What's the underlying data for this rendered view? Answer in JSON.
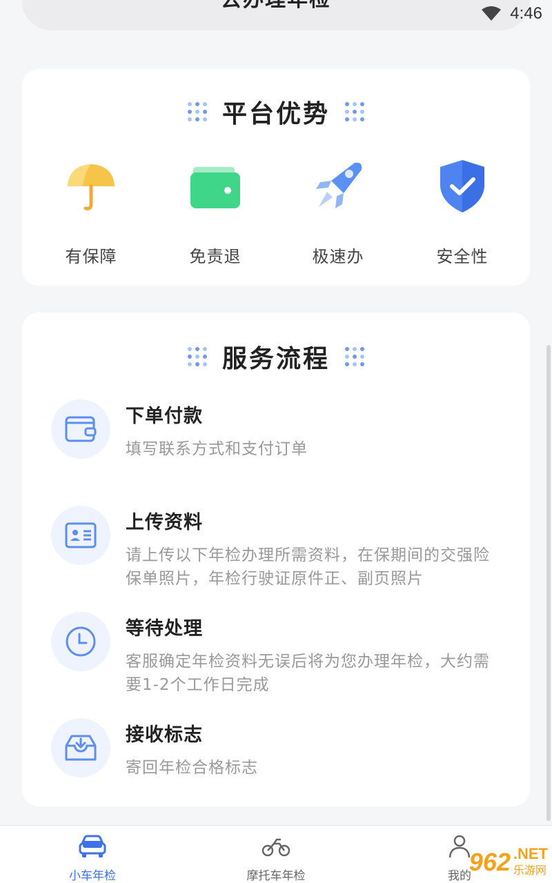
{
  "top_button": {
    "label": "去办理年检"
  },
  "status_bar": {
    "time": "4:46"
  },
  "advantages": {
    "title": "平台优势",
    "items": [
      {
        "label": "有保障",
        "icon": "umbrella-icon"
      },
      {
        "label": "免责退",
        "icon": "wallet-icon"
      },
      {
        "label": "极速办",
        "icon": "rocket-icon"
      },
      {
        "label": "安全性",
        "icon": "shield-check-icon"
      }
    ]
  },
  "process": {
    "title": "服务流程",
    "steps": [
      {
        "title": "下单付款",
        "desc": "填写联系方式和支付订单",
        "icon": "wallet-icon"
      },
      {
        "title": "上传资料",
        "desc": "请上传以下年检办理所需资料，在保期间的交强险保单照片，年检行驶证原件正、副页照片",
        "icon": "id-card-icon"
      },
      {
        "title": "等待处理",
        "desc": "客服确定年检资料无误后将为您办理年检，大约需要1-2个工作日完成",
        "icon": "clock-icon"
      },
      {
        "title": "接收标志",
        "desc": "寄回年检合格标志",
        "icon": "inbox-download-icon"
      }
    ]
  },
  "tabbar": {
    "tabs": [
      {
        "label": "小车年检",
        "icon": "car-icon",
        "active": true
      },
      {
        "label": "摩托车年检",
        "icon": "motorcycle-icon",
        "active": false
      },
      {
        "label": "我的",
        "icon": "user-icon",
        "active": false
      }
    ]
  },
  "watermark": {
    "logo": "962",
    "suffix": ".NET",
    "text": "乐游网"
  },
  "colors": {
    "accent": "#3d72e8",
    "card": "#ffffff",
    "background": "#f5f6f8"
  }
}
